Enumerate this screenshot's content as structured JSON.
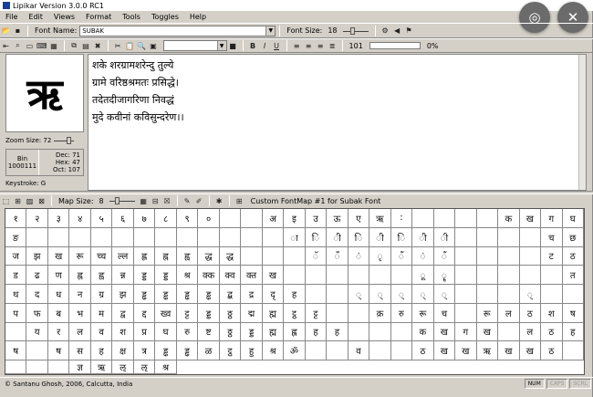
{
  "window": {
    "title": "Lipikar Version 3.0.0 RC1"
  },
  "menu": [
    "File",
    "Edit",
    "Views",
    "Format",
    "Tools",
    "Toggles",
    "Help"
  ],
  "toolbar1": {
    "font_label": "Font Name:",
    "font_value": "SUBAK",
    "size_label": "Font Size:",
    "size_value": "18"
  },
  "toolbar2": {
    "bold": "B",
    "italic": "I",
    "underline": "U",
    "count": "101",
    "percent": "0%"
  },
  "preview": {
    "glyph": "ऋ",
    "zoom_label": "Zoom Size:",
    "zoom_value": "72",
    "bin_label": "Bin",
    "bin_value": "1000111",
    "dec": "Dec: 71",
    "hex": "Hex: 47",
    "oct": "Oct: 107",
    "keystroke": "Keystroke: G"
  },
  "editor": {
    "lines": [
      "शके शरग्रामशरेन्दु तुल्ये",
      "ग्रामे वरिष्ठश्रमतः प्रसिद्धे।",
      "तदेतदीजागरिणा निवद्धं",
      "मुदे कवीनां कविसुन्दरेण।।"
    ]
  },
  "map_toolbar": {
    "size_label": "Map Size:",
    "size_value": "8",
    "fontmap_name": "Custom FontMap #1 for Subak Font"
  },
  "grid_cells": [
    "१",
    "२",
    "३",
    "४",
    "५",
    "६",
    "७",
    "८",
    "९",
    "०",
    "",
    "",
    "अ",
    "इ",
    "उ",
    "ऊ",
    "ए",
    "ऋ",
    ":",
    "",
    "",
    "",
    "",
    "क",
    "ख",
    "ग",
    "घ",
    "ङ",
    "",
    "",
    "",
    "",
    "",
    "",
    "",
    "",
    "",
    "",
    "",
    "",
    "ा",
    "ि",
    "ी",
    "ि",
    "ी",
    "ि",
    "ी",
    "ी",
    "",
    "",
    "",
    "",
    "च",
    "छ",
    "ज",
    "झ",
    "ख",
    "रू",
    "च्च",
    "ल्ल",
    "ह्ल",
    "ह्न",
    "ह्व",
    "द्ध",
    "द्ध",
    "",
    "",
    "",
    "ॅ",
    "ँ",
    "ं",
    "ृ",
    "ँ",
    "ं",
    "ँ",
    "",
    "",
    "",
    "",
    "ट",
    "ठ",
    "ड",
    "ढ",
    "ण",
    "ह्न",
    "ह्व",
    "न्न",
    "ड्ड",
    "ड्ड",
    "श्र",
    "क्क",
    "क्व",
    "क्त",
    "ख",
    "",
    "",
    "",
    "",
    "",
    "",
    "ू",
    "ॄ",
    "",
    "",
    "",
    "",
    "",
    "त",
    "थ",
    "द",
    "ध",
    "न",
    "ग्र",
    "झ",
    "ड्ढ",
    "ड्ढ",
    "ड्ढ",
    "ड्ढ",
    "द्ब",
    "द्र",
    "दृ",
    "ह",
    "",
    "",
    "्",
    "्",
    "्",
    "्",
    "्",
    "",
    "",
    "",
    "्",
    "",
    "",
    "प",
    "फ",
    "ब",
    "भ",
    "म",
    "द्व",
    "द्द",
    "ख्व",
    "ट्ट",
    "ड्ड",
    "ठ्ठ",
    "द्म",
    "ह्म",
    "ट्ठ",
    "ट्ट",
    "",
    "",
    "क़",
    "रु",
    "रू",
    "च",
    "",
    "रू",
    "ल",
    "ठ",
    "श",
    "ष",
    "",
    "य",
    "र",
    "ल",
    "व",
    "श",
    "प्र",
    "घ",
    "रु",
    "ष्ट",
    "ठ्ठ",
    "ड्ड",
    "ह्म",
    "ह्ल",
    "ह",
    "ह",
    "",
    "",
    "",
    "क",
    "ख",
    "ग",
    "ख",
    "",
    "ल",
    "ठ",
    "ह",
    "ष",
    "",
    "ष",
    "स",
    "ह",
    "क्ष",
    "त्र",
    "ड्ढ",
    "ड्ढ",
    "ळ",
    "ट्ठ",
    "हु",
    "श्र",
    "ॐ",
    "",
    "",
    "व",
    "",
    "",
    "ठ",
    "ख",
    "ख",
    "ऋ",
    "ख",
    "ख",
    "ठ",
    "",
    "",
    "",
    "",
    "ज्ञ",
    "ऋ",
    "ऌ",
    "ऌ",
    "श्र"
  ],
  "status": {
    "text": "© Santanu Ghosh, 2006, Calcutta, India",
    "num": "NUM",
    "caps": "CAPS",
    "scrl": "SCRL"
  }
}
